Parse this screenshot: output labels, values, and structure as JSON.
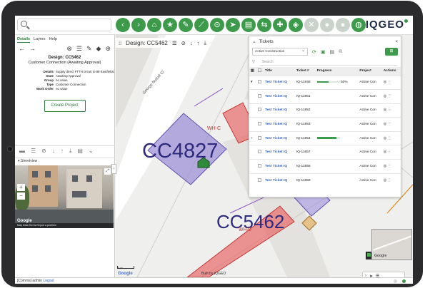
{
  "header": {
    "search_placeholder": "",
    "brand": "IQGEO",
    "toolbar_icons": [
      "back-icon",
      "forward-icon",
      "home-icon",
      "star-icon",
      "pencil-icon",
      "ruler-icon",
      "location-icon",
      "navigate-icon",
      "print-icon",
      "share-icon",
      "network-icon",
      "layers-icon",
      "disabled-icon",
      "disabled-icon",
      "disabled-icon",
      "globe-icon"
    ]
  },
  "left_panel": {
    "tabs": [
      "Details",
      "Layers",
      "Help"
    ],
    "design_title": "Design: CC5462",
    "design_subtitle": "Customer Connection (Awaiting Approval)",
    "properties": [
      {
        "key": "Details",
        "value": "Supply direct FTTH circuit to 89 Eastfields"
      },
      {
        "key": "State",
        "value": "Awaiting Approval"
      },
      {
        "key": "Group",
        "value": "no value"
      },
      {
        "key": "Type",
        "value": "Customer Connection"
      },
      {
        "key": "Work Order",
        "value": "no value"
      }
    ],
    "create_button": "Create Project",
    "streetview_label": "Streetview",
    "sv_google": "Google",
    "sv_footer": "Map Data   Terms   Report a problem"
  },
  "map": {
    "design_bar_title": "Design: CC5462",
    "street_label": "George Nuttall Cl",
    "cc_label_1": "CC4827",
    "cc_label_2": "CC5462",
    "wh_label_1": "WH-C",
    "wh_label_2": "WH-0",
    "scale": "5 m",
    "google": "Google",
    "built_by": "Built by IQGEO",
    "minimap_google": "Google"
  },
  "tickets": {
    "title": "Tickets",
    "filter": "Active Construction",
    "search_placeholder": "Search",
    "columns": [
      "Title",
      "Ticket #",
      "Progress",
      "Project",
      "Actions"
    ],
    "rows": [
      {
        "title": "Test Ticket IQ",
        "ticket": "IQ-11848",
        "progress": 0.5,
        "progress_label": "50%",
        "project": "Active Con"
      },
      {
        "title": "Test Ticket IQ",
        "ticket": "IQ-11851",
        "progress": null,
        "progress_label": "",
        "project": "Active Con"
      },
      {
        "title": "Test Ticket IQ",
        "ticket": "IQ-11852",
        "progress": null,
        "progress_label": "",
        "project": "Active Con"
      },
      {
        "title": "Test Ticket IQ",
        "ticket": "IQ-11853",
        "progress": null,
        "progress_label": "",
        "project": "Active Con"
      },
      {
        "title": "Test Ticket IQ",
        "ticket": "IQ-11854",
        "progress": 0.85,
        "progress_label": "",
        "project": "Active Con"
      },
      {
        "title": "Test Ticket IQ",
        "ticket": "IQ-11857",
        "progress": null,
        "progress_label": "",
        "project": "Active Con"
      },
      {
        "title": "Test Ticket IQ",
        "ticket": "IQ-11858",
        "progress": null,
        "progress_label": "",
        "project": "Active Con"
      },
      {
        "title": "Test Ticket IQ",
        "ticket": "IQ-11859",
        "progress": null,
        "progress_label": "",
        "project": "Active Con"
      }
    ]
  },
  "status": {
    "user_prefix": "[Comms] admin",
    "logout": "Logout"
  },
  "colors": {
    "accent": "#3d9a4a",
    "label_blue": "#2e2a7e",
    "link": "#2d63c8",
    "design_red": "#d44c4c",
    "design_purple": "#7d6fc7"
  }
}
